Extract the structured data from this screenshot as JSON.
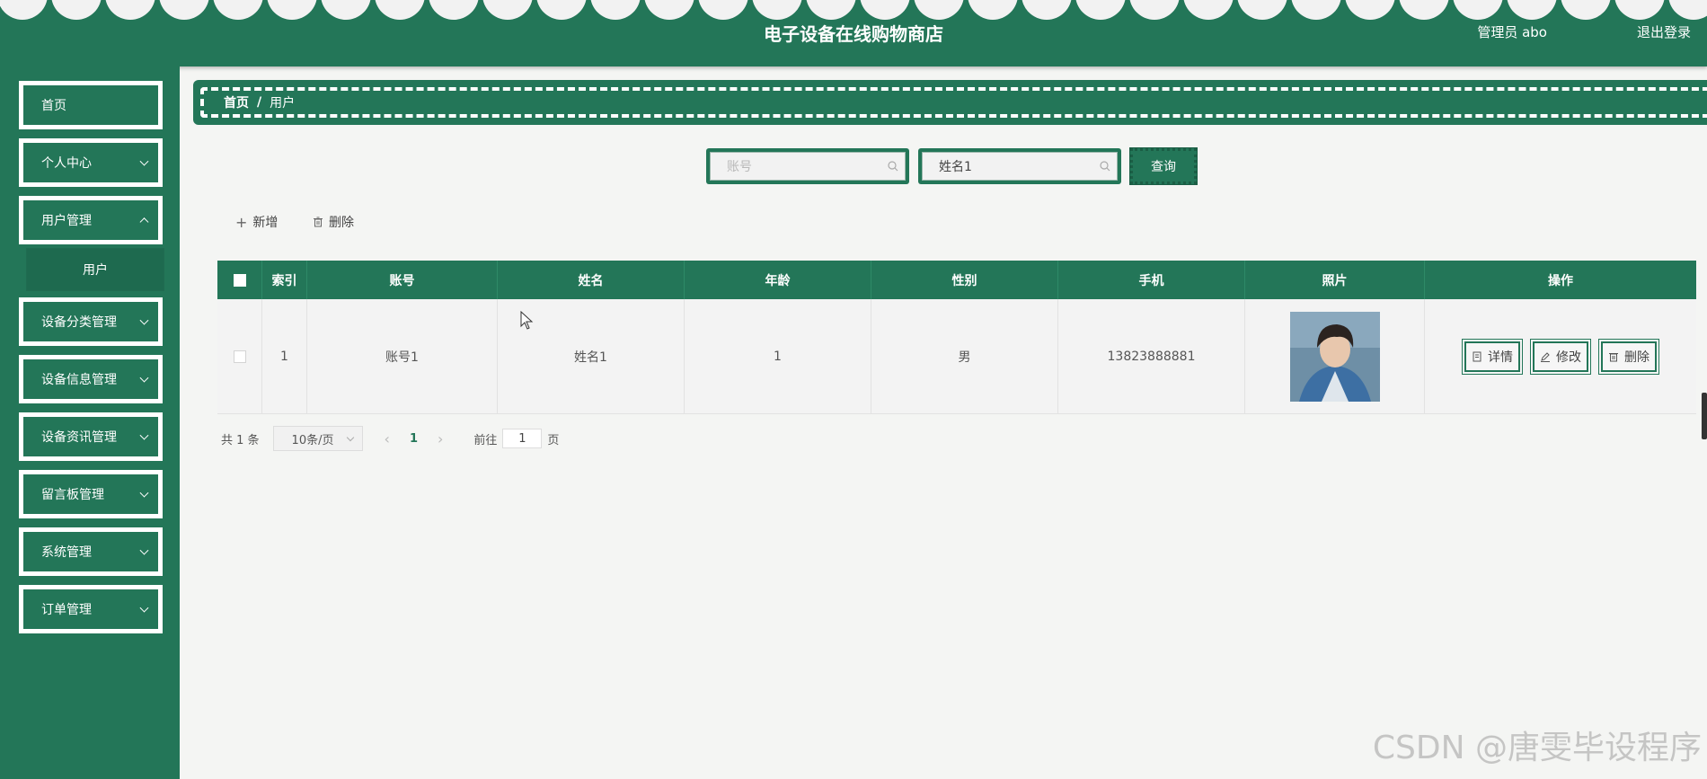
{
  "header": {
    "title": "电子设备在线购物商店",
    "user": "管理员 abo",
    "logout": "退出登录"
  },
  "sidebar": {
    "items": [
      {
        "label": "首页"
      },
      {
        "label": "个人中心"
      },
      {
        "label": "用户管理"
      },
      {
        "label": "设备分类管理"
      },
      {
        "label": "设备信息管理"
      },
      {
        "label": "设备资讯管理"
      },
      {
        "label": "留言板管理"
      },
      {
        "label": "系统管理"
      },
      {
        "label": "订单管理"
      }
    ],
    "sub_item": "用户"
  },
  "breadcrumb": {
    "home": "首页",
    "separator": "/",
    "current": "用户"
  },
  "search": {
    "account_placeholder": "账号",
    "name_value": "姓名1",
    "button": "查询"
  },
  "actions": {
    "add": "新增",
    "delete": "删除"
  },
  "table": {
    "columns": [
      "索引",
      "账号",
      "姓名",
      "年龄",
      "性别",
      "手机",
      "照片",
      "操作"
    ],
    "rows": [
      {
        "index": "1",
        "account": "账号1",
        "name": "姓名1",
        "age": "1",
        "gender": "男",
        "phone": "13823888881"
      }
    ],
    "ops": {
      "detail": "详情",
      "edit": "修改",
      "delete": "删除"
    }
  },
  "pagination": {
    "total": "共 1 条",
    "page_size": "10条/页",
    "current_page": "1",
    "goto_label": "前往",
    "goto_value": "1",
    "page_suffix": "页"
  },
  "watermark": "CSDN @唐雯毕设程序",
  "colors": {
    "primary": "#237658"
  }
}
